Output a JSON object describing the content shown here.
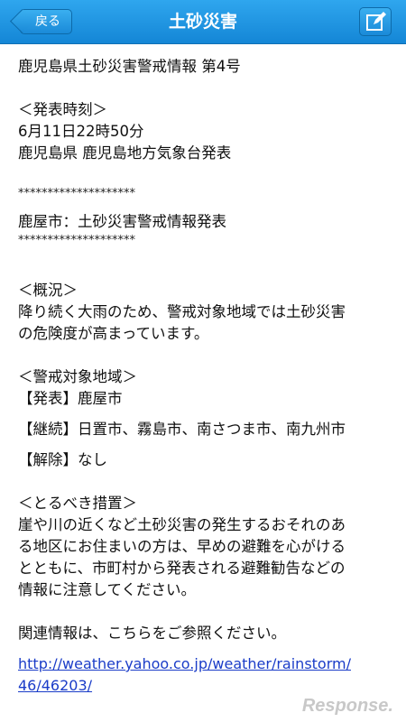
{
  "nav": {
    "back_label": "戻る",
    "title": "土砂災害",
    "compose_icon": "compose-icon"
  },
  "content": {
    "heading": "鹿児島県土砂災害警戒情報 第4号",
    "announce_header": "＜発表時刻＞",
    "announce_time": "6月11日22時50分",
    "announce_source": "鹿児島県 鹿児島地方気象台発表",
    "stars_top": "********************",
    "city_line": "鹿屋市：土砂災害警戒情報発表",
    "stars_bottom": "********************",
    "overview_header": "＜概況＞",
    "overview_1": "降り続く大雨のため、警戒対象地域では土砂災害",
    "overview_2": "の危険度が高まっています。",
    "areas_header": "＜警戒対象地域＞",
    "area_issue_label": "【発表】",
    "area_issue_value": "鹿屋市",
    "area_continue_label": "【継続】",
    "area_continue_value": "日置市、霧島市、南さつま市、南九州市",
    "area_cancel_label": "【解除】",
    "area_cancel_value": "なし",
    "measures_header": "＜とるべき措置＞",
    "measures_1": "崖や川の近くなど土砂災害の発生するおそれのあ",
    "measures_2": "る地区にお住まいの方は、早めの避難を心がける",
    "measures_3": "とともに、市町村から発表される避難勧告などの",
    "measures_4": "情報に注意してください。",
    "related_text": "関連情報は、こちらをご参照ください。",
    "link_1": "http://weather.yahoo.co.jp/weather/rainstorm/",
    "link_2": "46/46203/"
  },
  "watermark": "Response."
}
